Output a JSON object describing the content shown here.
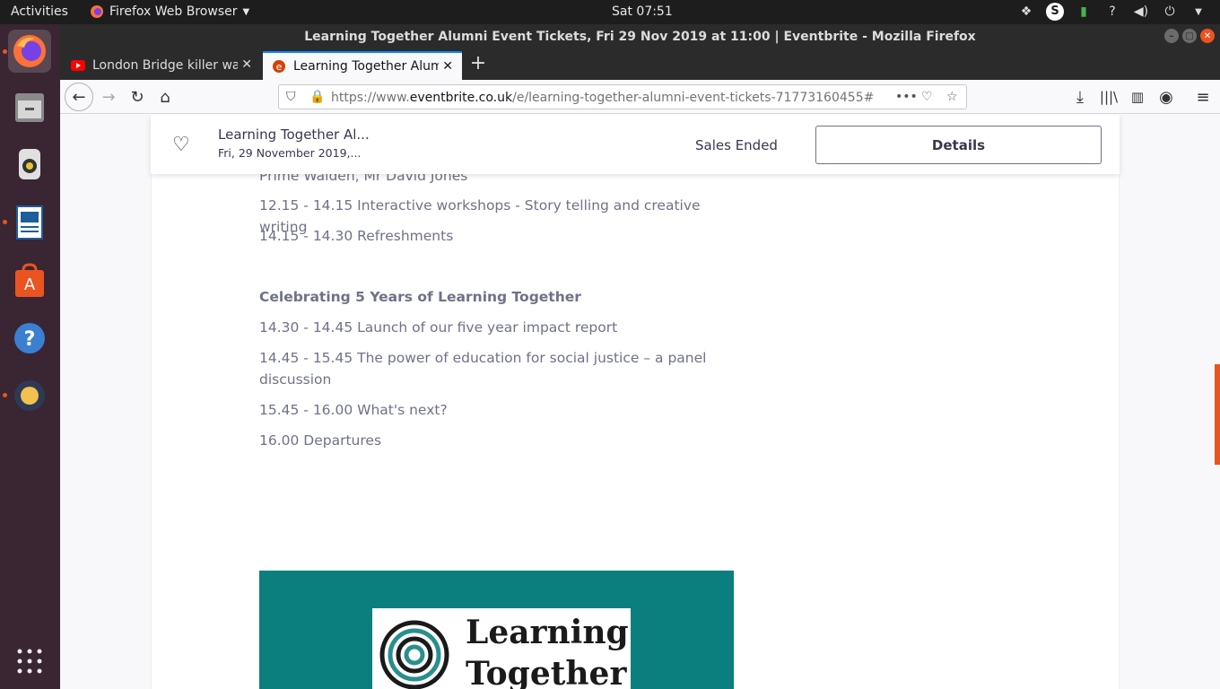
{
  "topbar": {
    "activities": "Activities",
    "app_name": "Firefox Web Browser",
    "clock": "Sat 07:51"
  },
  "window": {
    "title": "Learning Together Alumni Event Tickets, Fri 29 Nov 2019 at 11:00 | Eventbrite - Mozilla Firefox"
  },
  "tabs": [
    {
      "label": "London Bridge killer was",
      "icon": "youtube-icon",
      "active": false
    },
    {
      "label": "Learning Together Alumn",
      "icon": "eventbrite-icon",
      "active": true
    }
  ],
  "urlbar": {
    "prefix": "https://www.",
    "domain": "eventbrite.co.uk",
    "path": "/e/learning-together-alumni-event-tickets-71773160455#"
  },
  "sticky_header": {
    "event_title": "Learning Together Al...",
    "event_date": "Fri, 29 November 2019,...",
    "status": "Sales Ended",
    "details_label": "Details"
  },
  "agenda": {
    "partial_line": "Prime Walden, Mr David Jones",
    "items_top": [
      "12.15 - 14.15 Interactive workshops - Story telling and creative writing",
      "14.15 - 14.30 Refreshments"
    ],
    "section_heading": "Celebrating 5 Years of Learning Together",
    "items_bottom": [
      "14.30 - 14.45 Launch of our five year impact report",
      "14.45 - 15.45 The power of education for social justice – a panel discussion",
      "15.45 - 16.00 What's next?",
      "16.00 Departures"
    ]
  },
  "logo": {
    "line1": "Learning",
    "line2": "Together"
  },
  "colors": {
    "accent": "#e95420",
    "banner": "#0a7f7e",
    "text": "#6f7287"
  }
}
